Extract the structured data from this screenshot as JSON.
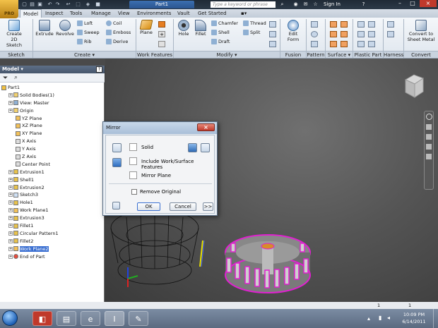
{
  "app": {
    "logo_text": "PRO",
    "doc_tab": "Part1",
    "search_placeholder": "Type a keyword or phrase",
    "sign_in": "Sign In"
  },
  "ribbon_tabs": [
    "Model",
    "Inspect",
    "Tools",
    "Manage",
    "View",
    "Environments",
    "Vault",
    "Get Started"
  ],
  "ribbon": {
    "create_2d_sketch": "Create\n2D Sketch",
    "extrude": "Extrude",
    "revolve": "Revolve",
    "loft": "Loft",
    "sweep": "Sweep",
    "rib": "Rib",
    "coil": "Coil",
    "emboss": "Emboss",
    "derive": "Derive",
    "plane": "Plane",
    "hole": "Hole",
    "fillet": "Fillet",
    "chamfer": "Chamfer",
    "shell": "Shell",
    "draft": "Draft",
    "thread": "Thread",
    "split": "Split",
    "edit_form": "Edit\nForm",
    "convert": "Convert to\nSheet Metal",
    "panels": {
      "sketch": "Sketch",
      "create": "Create",
      "work_features": "Work Features",
      "modify": "Modify",
      "fusion": "Fusion",
      "pattern": "Pattern",
      "surface": "Surface",
      "plastic_part": "Plastic Part",
      "harness": "Harness",
      "convert": "Convert"
    }
  },
  "browser": {
    "title": "Model",
    "items": [
      {
        "label": "Part1",
        "indent": 0,
        "icon": "part-icon"
      },
      {
        "label": "Solid Bodies(1)",
        "indent": 1,
        "icon": "folder-icon"
      },
      {
        "label": "View: Master",
        "indent": 1,
        "icon": "view-icon"
      },
      {
        "label": "Origin",
        "indent": 1,
        "icon": "folder-icon"
      },
      {
        "label": "YZ Plane",
        "indent": 2,
        "icon": "plane-icon"
      },
      {
        "label": "XZ Plane",
        "indent": 2,
        "icon": "plane-icon"
      },
      {
        "label": "XY Plane",
        "indent": 2,
        "icon": "plane-icon"
      },
      {
        "label": "X Axis",
        "indent": 2,
        "icon": "axis-icon"
      },
      {
        "label": "Y Axis",
        "indent": 2,
        "icon": "axis-icon"
      },
      {
        "label": "Z Axis",
        "indent": 2,
        "icon": "axis-icon"
      },
      {
        "label": "Center Point",
        "indent": 2,
        "icon": "point-icon"
      },
      {
        "label": "Extrusion1",
        "indent": 1,
        "icon": "extrusion-icon"
      },
      {
        "label": "Shell1",
        "indent": 1,
        "icon": "shell-icon"
      },
      {
        "label": "Extrusion2",
        "indent": 1,
        "icon": "extrusion-icon"
      },
      {
        "label": "Sketch3",
        "indent": 1,
        "icon": "sketch-icon"
      },
      {
        "label": "Hole1",
        "indent": 1,
        "icon": "hole-icon"
      },
      {
        "label": "Work Plane1",
        "indent": 1,
        "icon": "plane-icon"
      },
      {
        "label": "Extrusion3",
        "indent": 1,
        "icon": "extrusion-icon"
      },
      {
        "label": "Fillet1",
        "indent": 1,
        "icon": "fillet-icon"
      },
      {
        "label": "Circular Pattern1",
        "indent": 1,
        "icon": "pattern-icon"
      },
      {
        "label": "Fillet2",
        "indent": 1,
        "icon": "fillet-icon"
      },
      {
        "label": "Work Plane2",
        "indent": 1,
        "icon": "plane-icon"
      },
      {
        "label": "End of Part",
        "indent": 1,
        "icon": "end-icon"
      }
    ]
  },
  "dialog": {
    "title": "Mirror",
    "solid": "Solid",
    "include_features": "Include Work/Surface Features",
    "mirror_plane": "Mirror Plane",
    "remove_original": "Remove Original",
    "ok": "OK",
    "cancel": "Cancel",
    "more": ">>"
  },
  "status": {
    "left": "1",
    "right": "1"
  },
  "clock": {
    "time": "10:09 PM",
    "date": "6/14/2011"
  },
  "colors": {
    "accent": "#3a6fd1",
    "magenta": "#e020d0"
  }
}
